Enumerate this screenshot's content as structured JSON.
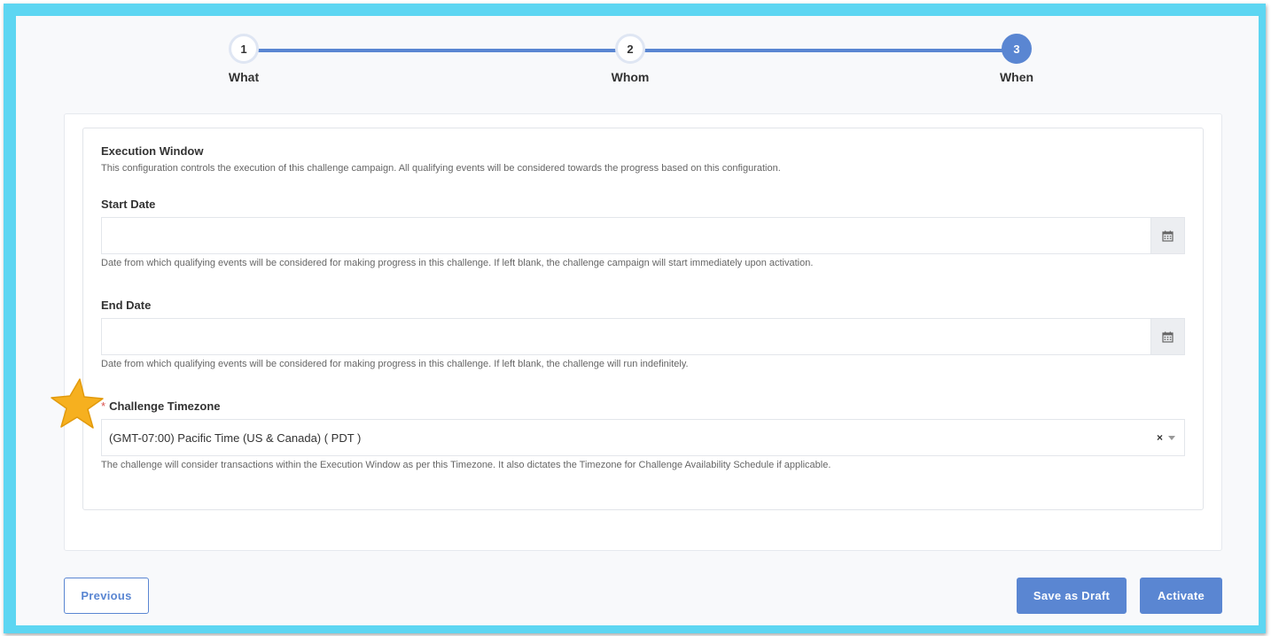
{
  "stepper": {
    "steps": [
      {
        "number": "1",
        "label": "What",
        "state": "completed"
      },
      {
        "number": "2",
        "label": "Whom",
        "state": "completed"
      },
      {
        "number": "3",
        "label": "When",
        "state": "active"
      }
    ]
  },
  "execution_window": {
    "title": "Execution Window",
    "description": "This configuration controls the execution of this challenge campaign. All qualifying events will be considered towards the progress based on this configuration."
  },
  "start_date": {
    "label": "Start Date",
    "value": "",
    "help": "Date from which qualifying events will be considered for making progress in this challenge. If left blank, the challenge campaign will start immediately upon activation.",
    "icon": "calendar-icon"
  },
  "end_date": {
    "label": "End Date",
    "value": "",
    "help": "Date from which qualifying events will be considered for making progress in this challenge. If left blank, the challenge will run indefinitely.",
    "icon": "calendar-icon"
  },
  "timezone": {
    "required_marker": "*",
    "label": "Challenge Timezone",
    "selected": "(GMT-07:00) Pacific Time (US & Canada) ( PDT )",
    "clear_symbol": "×",
    "help": "The challenge will consider transactions within the Execution Window as per this Timezone. It also dictates the Timezone for Challenge Availability Schedule if applicable."
  },
  "buttons": {
    "previous": "Previous",
    "save_draft": "Save as Draft",
    "activate": "Activate"
  },
  "colors": {
    "frame": "#5dd6f2",
    "accent": "#5a86d2",
    "star": "#f6b01f",
    "required": "#d9534f"
  }
}
